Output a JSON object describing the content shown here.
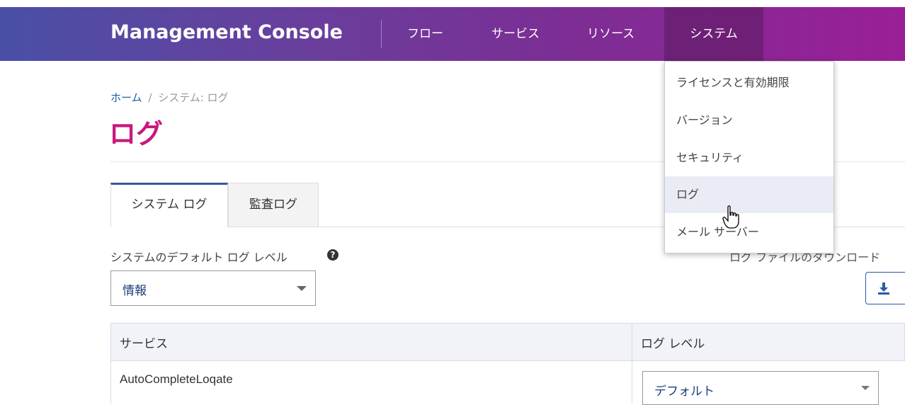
{
  "header": {
    "brand": "Management Console",
    "nav": [
      "フロー",
      "サービス",
      "リソース",
      "システム"
    ],
    "active_nav": "システム"
  },
  "breadcrumb": {
    "home": "ホーム",
    "separator": "/",
    "current": "システム: ログ"
  },
  "page_title": "ログ",
  "tabs": [
    "システム ログ",
    "監査ログ"
  ],
  "active_tab": "システム ログ",
  "default_level": {
    "label": "システムのデフォルト ログ レベル",
    "help_icon": "question-circle-icon",
    "value": "情報"
  },
  "download": {
    "label": "ログ ファイルのダウンロード",
    "icon": "download-icon"
  },
  "table": {
    "headers": [
      "サービス",
      "ログ レベル"
    ],
    "rows": [
      {
        "service": "AutoCompleteLoqate",
        "level": "デフォルト"
      }
    ]
  },
  "system_menu": {
    "items": [
      "ライセンスと有効期限",
      "バージョン",
      "セキュリティ",
      "ログ",
      "メール サーバー"
    ],
    "hovered": "ログ"
  },
  "colors": {
    "title": "#c8177f",
    "link": "#1a5ea8",
    "tab_accent": "#3a55a5"
  }
}
